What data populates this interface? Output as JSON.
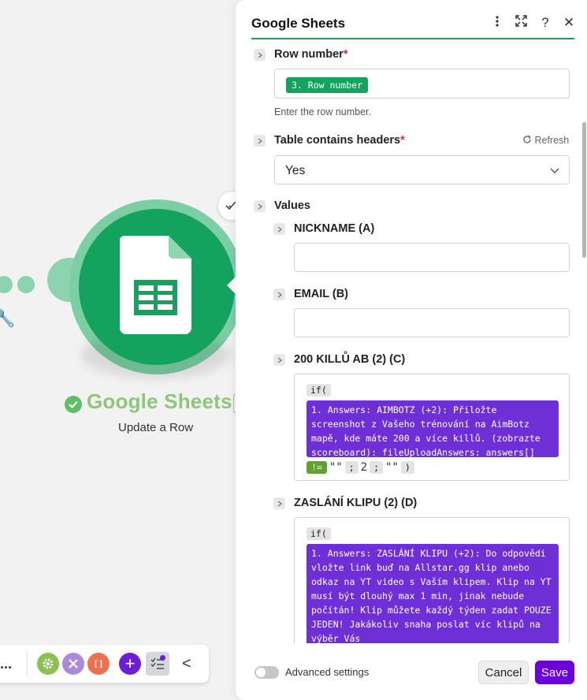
{
  "canvas": {
    "module": {
      "title": "Google Sheets",
      "subtitle": "Update a Row"
    },
    "toolbar": {
      "more_label": "...",
      "tools_icon": "gear-icon",
      "flow_control_icon": "tools-icon",
      "text_parser_label": "[ ]",
      "add_label": "+",
      "collapse_label": "<"
    }
  },
  "panel": {
    "title": "Google Sheets",
    "header_icons": [
      "kebab-menu-icon",
      "expand-icon",
      "help-icon",
      "close-icon"
    ],
    "help_label": "?",
    "close_label": "✕",
    "accent_color": "#13a35e",
    "fields": {
      "row_number": {
        "label": "Row number",
        "required_mark": "*",
        "value_pill": "3. Row number",
        "hint": "Enter the row number."
      },
      "table_headers": {
        "label": "Table contains headers",
        "required_mark": "*",
        "refresh_label": "Refresh",
        "selected": "Yes"
      },
      "values": {
        "label": "Values",
        "nickname": {
          "label": "NICKNAME (A)",
          "value": ""
        },
        "email": {
          "label": "EMAIL (B)",
          "value": ""
        },
        "kills": {
          "label": "200 KILLŮ AB (2) (C)",
          "if_token": "if(",
          "answer_block": "1. Answers: AIMBOTZ (+2): Přiložte screenshot z Vašeho trénování na AimBotz mapě, kde máte 200 a více killů. (zobrazte scoreboard): fileUploadAnswers: answers[]",
          "operator": "!=",
          "empty_string": "\"\"",
          "separator": ";",
          "true_value": "2",
          "false_value": "\"\"",
          "close_token": ")"
        },
        "clip": {
          "label": "ZASLÁNÍ KLIPU (2) (D)",
          "if_token": "if(",
          "answer_block": "1. Answers: ZASLÁNÍ KLIPU (+2): Do odpovědi vložte link buď na Allstar.gg klip anebo odkaz na YT video s Vaším klipem. Klip na YT musí být dlouhý max 1 min, jinak nebude počítán! Klip můžete každý týden zadat POUZE JEDEN! Jakákoliv snaha poslat víc klipů na výběr Vás"
        }
      }
    },
    "footer": {
      "advanced_label": "Advanced settings",
      "advanced_enabled": false,
      "cancel_label": "Cancel",
      "save_label": "Save",
      "save_color": "#6c00d9"
    }
  }
}
